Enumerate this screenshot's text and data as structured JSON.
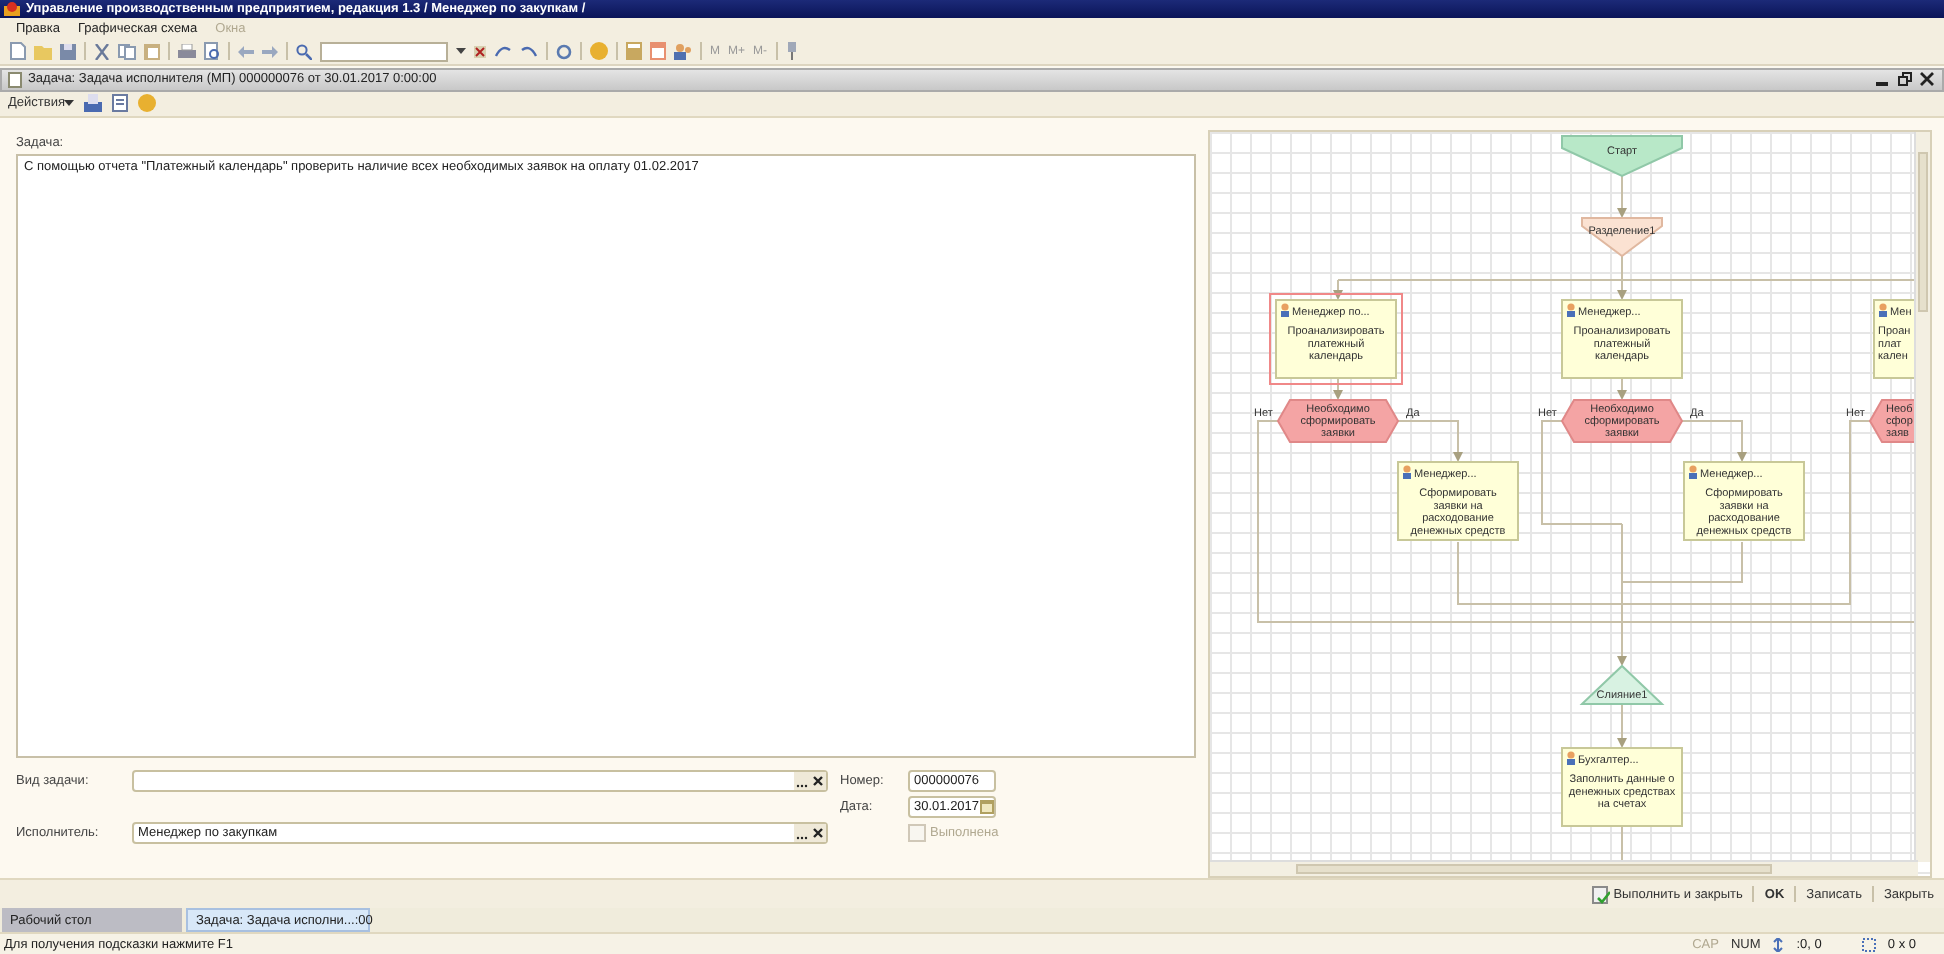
{
  "window": {
    "title": "Управление производственным предприятием, редакция 1.3 / Менеджер по закупкам /"
  },
  "menu": [
    {
      "label": "Правка",
      "disabled": false
    },
    {
      "label": "Графическая схема",
      "disabled": false
    },
    {
      "label": "Окна",
      "disabled": true
    }
  ],
  "toolbar": {
    "memory_buttons": [
      "М",
      "М+",
      "М-"
    ]
  },
  "document": {
    "title": "Задача: Задача исполнителя (МП) 000000076 от 30.01.2017 0:00:00",
    "actions": "Действия"
  },
  "task": {
    "label": "Задача:",
    "text": "С помощью отчета \"Платежный календарь\" проверить наличие всех необходимых заявок на оплату 01.02.2017"
  },
  "form": {
    "task_type": {
      "label": "Вид задачи:"
    },
    "number": {
      "label": "Номер:",
      "value": "000000076"
    },
    "date": {
      "label": "Дата:",
      "value": "30.01.2017"
    },
    "executor": {
      "label": "Исполнитель:",
      "value": "Менеджер по закупкам"
    },
    "done": {
      "label": "Выполнена",
      "checked": false,
      "disabled": true
    }
  },
  "diagram": {
    "nodes": [
      {
        "kind": "start",
        "lines": [
          "Старт"
        ]
      },
      {
        "kind": "split",
        "lines": [
          "Разделение1"
        ]
      },
      {
        "kind": "task",
        "role": "Менеджер  по...",
        "lines": [
          "Проанализировать",
          "платежный",
          "календарь"
        ],
        "selected": true
      },
      {
        "kind": "decision",
        "lines": [
          "Необходимо",
          "сформировать",
          "заявки"
        ],
        "no_label": "Нет",
        "yes_label": "Да"
      },
      {
        "kind": "task",
        "role": "Менеджер...",
        "lines": [
          "Сформировать",
          "заявки на",
          "расходование",
          "денежных средств"
        ],
        "selected": false
      },
      {
        "kind": "task",
        "role": "Менеджер...",
        "lines": [
          "Проанализировать",
          "платежный",
          "календарь"
        ],
        "selected": false
      },
      {
        "kind": "decision",
        "lines": [
          "Необходимо",
          "сформировать",
          "заявки"
        ],
        "no_label": "Нет",
        "yes_label": "Да"
      },
      {
        "kind": "task",
        "role": "Менеджер...",
        "lines": [
          "Сформировать",
          "заявки на",
          "расходование",
          "денежных средств"
        ],
        "selected": false
      },
      {
        "kind": "task",
        "role": "Мен",
        "lines": [
          "Проан",
          "плат",
          "кален"
        ],
        "selected": false
      },
      {
        "kind": "decision",
        "lines": [
          "Необ",
          "сфор",
          "заяв"
        ],
        "no_label": "Нет"
      },
      {
        "kind": "merge",
        "lines": [
          "Слияние1"
        ]
      },
      {
        "kind": "task",
        "role": "Бухгалтер...",
        "lines": [
          "Заполнить данные о",
          "денежных средствах",
          "на счетах"
        ],
        "selected": false
      }
    ]
  },
  "buttons": [
    {
      "label": "Выполнить и закрыть",
      "icon": true,
      "default": false
    },
    {
      "label": "OK",
      "icon": false,
      "default": true
    },
    {
      "label": "Записать",
      "icon": false,
      "default": false
    },
    {
      "label": "Закрыть",
      "icon": false,
      "default": false
    }
  ],
  "taskbar": [
    {
      "label": "Рабочий стол",
      "selected": false
    },
    {
      "label": "Задача: Задача исполни...:00",
      "selected": true
    }
  ],
  "status_bar": {
    "hint": "Для получения подсказки нажмите F1",
    "indicators": [
      {
        "label": "CAP",
        "on": false
      },
      {
        "label": "NUM",
        "on": true
      }
    ],
    "position": ":0, 0",
    "size": "0 x 0"
  }
}
